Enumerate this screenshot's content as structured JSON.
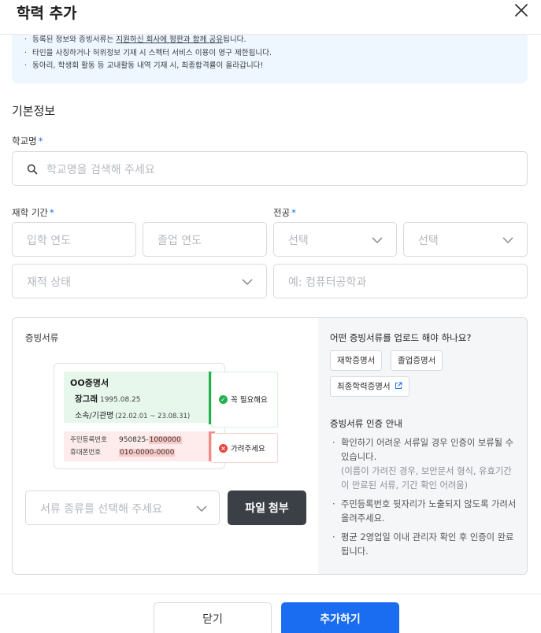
{
  "header": {
    "title": "학력 추가",
    "close_icon": "close-icon"
  },
  "notice": {
    "line1_pre": "등록된 정보와 증빙서류는 ",
    "line1_link": "지원하신 회사에 평판과 함께 공유",
    "line1_post": "됩니다.",
    "line2": "타인을 사칭하거나 허위정보 기재 시 스펙터 서비스 이용이 영구 제한됩니다.",
    "line3": "동아리, 학생회 활동 등 교내활동 내역 기재 시, 최종합격률이 올라갑니다!"
  },
  "basic": {
    "section_title": "기본정보",
    "school_label": "학교명",
    "required_mark": "*",
    "school_placeholder": "학교명을 검색해 주세요",
    "period_label": "재학 기간",
    "major_label": "전공",
    "entry_placeholder": "입학 연도",
    "grad_placeholder": "졸업 연도",
    "major_select1": "선택",
    "major_select2": "선택",
    "status_placeholder": "재적 상태",
    "major_placeholder": "예: 컴퓨터공학과"
  },
  "documents": {
    "label": "증빙서류",
    "sample": {
      "name": "OO증명서",
      "person": "장그래",
      "birth": "1995.08.25",
      "org": "소속/기관명",
      "org_period": "(22.02.01 ~ 23.08.31)",
      "rrn_key": "주민등록번호",
      "rrn_visible": "950825-",
      "rrn_hidden": "1000000",
      "phone_key": "휴대폰번호",
      "phone_value": "010-0000-0000",
      "need_tag": "꼭 필요해요",
      "hide_tag": "가려주세요"
    },
    "select_placeholder": "서류 종류를 선택해 주세요",
    "attach_button": "파일 첨부",
    "question": "어떤 증빙서류를 업로드 해야 하나요?",
    "chips": [
      "재학증명서",
      "졸업증명서",
      "최종학력증명서"
    ],
    "guide_title": "증빙서류 인증 안내",
    "guides": [
      {
        "text": "확인하기 어려운 서류일 경우 인증이 보류될 수 있습니다.",
        "sub": "(이름이 가려진 경우, 보안문서 형식, 유효기간이 만료된 서류, 기간 확인 어려움)"
      },
      {
        "text": "주민등록번호 뒷자리가 노출되지 않도록 가려서 올려주세요.",
        "sub": ""
      },
      {
        "text": "평균 2영업일 이내 관리자 확인 후 인증이 완료됩니다.",
        "sub": ""
      }
    ]
  },
  "footer": {
    "close_button": "닫기",
    "add_button": "추가하기"
  },
  "colors": {
    "accent": "#1a6cf0",
    "dark_button": "#3b3f46",
    "notice_bg": "#eef6ff",
    "success": "#22b14c",
    "danger": "#e8453c"
  }
}
